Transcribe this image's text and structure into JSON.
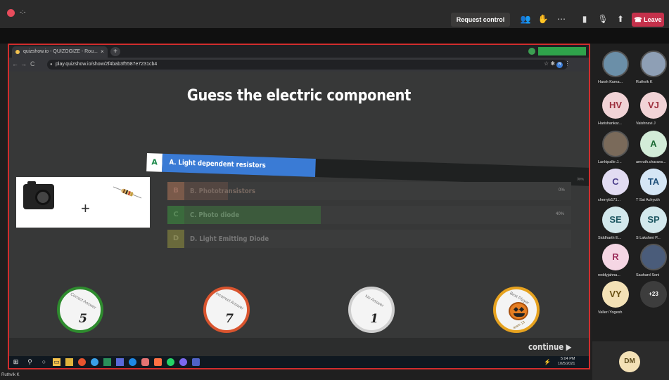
{
  "teams": {
    "timer": "-:-",
    "request_control": "Request control",
    "leave": "Leave",
    "presenter": "Ruthvik K"
  },
  "browser": {
    "tab_title": "quizshow.io - QUIZOGIZE - Rou...",
    "tab_close": "×",
    "new_tab": "+",
    "url": "play.quizshow.io/show/2f4bab3f5587e7231cb4"
  },
  "quiz": {
    "question": "Guess the electric component",
    "options": [
      {
        "letter": "A",
        "text": "A. Light dependent resistors",
        "percent": "30%",
        "fill": 0.3,
        "state": "selected"
      },
      {
        "letter": "B",
        "text": "B. Phototransistors",
        "percent": "0%",
        "fill": 0.1,
        "state": "faded"
      },
      {
        "letter": "C",
        "text": "C. Photo diode",
        "percent": "40%",
        "fill": 0.4,
        "state": "faded"
      },
      {
        "letter": "D",
        "text": "D. Light Emitting Diode",
        "percent": "",
        "fill": 0.0,
        "state": "faded"
      }
    ],
    "stats": [
      {
        "caption": "Correct Answer",
        "value": "5",
        "ring": "#2e8b2e"
      },
      {
        "caption": "Incorrect Answer",
        "value": "7",
        "ring": "#d9542e"
      },
      {
        "caption": "No Answer",
        "value": "1",
        "ring": "#bdbdbd"
      },
      {
        "caption": "Best Player",
        "value": "team 13",
        "ring": "#e6a21f"
      }
    ],
    "continue_label": "continue ▶"
  },
  "taskbar": {
    "time": "5:04 PM",
    "date": "10/5/2021"
  },
  "participants": [
    {
      "name": "Harsh Kuma...",
      "initials": "",
      "bg": "#6b8fa8",
      "fg": "#fff",
      "photo": true
    },
    {
      "name": "Ruthvik K",
      "initials": "",
      "bg": "#8e9fb5",
      "fg": "#fff",
      "photo": true
    },
    {
      "name": "Harishankar...",
      "initials": "HV",
      "bg": "#f1d3d6",
      "fg": "#9d2f3d"
    },
    {
      "name": "Vaishnavi J",
      "initials": "VJ",
      "bg": "#f1d3d6",
      "fg": "#9d2f3d"
    },
    {
      "name": "Lankipalle J...",
      "initials": "",
      "bg": "#7a6a5a",
      "fg": "#fff",
      "photo": true
    },
    {
      "name": "amruth.charans...",
      "initials": "A",
      "bg": "#d3ecd8",
      "fg": "#1e6b35"
    },
    {
      "name": "cherryb171...",
      "initials": "C",
      "bg": "#e2dcf2",
      "fg": "#4a3d8a"
    },
    {
      "name": "T Sai Achyuth",
      "initials": "TA",
      "bg": "#d5e6f5",
      "fg": "#1d4f7a"
    },
    {
      "name": "Siddharth E...",
      "initials": "SE",
      "bg": "#d3e8ec",
      "fg": "#1c5560"
    },
    {
      "name": "S Lakshmi P...",
      "initials": "SP",
      "bg": "#d3e8ec",
      "fg": "#1c5560"
    },
    {
      "name": "reddyjahna...",
      "initials": "R",
      "bg": "#f5d6e4",
      "fg": "#9b2d5a"
    },
    {
      "name": "Sauhard Soni",
      "initials": "",
      "bg": "#4a5c7a",
      "fg": "#fff",
      "photo": true
    },
    {
      "name": "Valleri Yogesh",
      "initials": "VY",
      "bg": "#f3e1b6",
      "fg": "#6a5214"
    },
    {
      "name": "",
      "initials": "+23",
      "bg": "#3d3d3d",
      "fg": "#fff"
    }
  ],
  "self_initials": "DM",
  "colors": {
    "accent_blue": "#3a7bd5",
    "option_letter_green": "#1f8a4c",
    "share_border": "#d12d2d",
    "leave_red": "#c4314b"
  }
}
